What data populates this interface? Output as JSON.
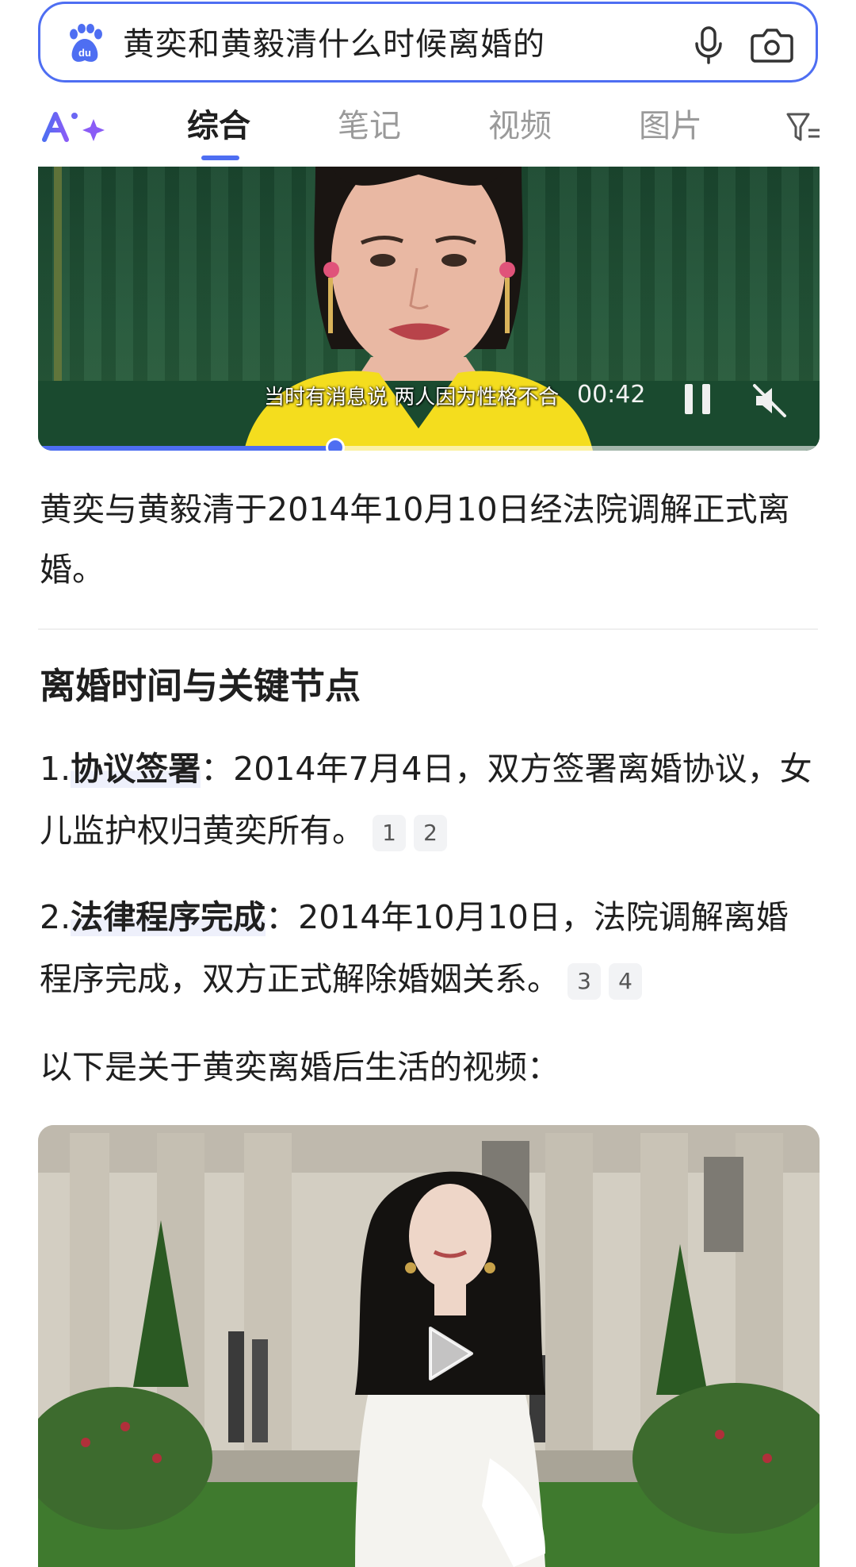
{
  "search": {
    "query": "黄奕和黄毅清什么时候离婚的",
    "logo_icon": "baidu-paw-icon",
    "mic_icon": "microphone-icon",
    "camera_icon": "camera-icon"
  },
  "tabs": {
    "ai_label": "Ai+",
    "items": [
      {
        "label": "综合",
        "active": true
      },
      {
        "label": "笔记",
        "active": false
      },
      {
        "label": "视频",
        "active": false
      },
      {
        "label": "图片",
        "active": false
      }
    ],
    "filter_icon": "filter-icon"
  },
  "video1": {
    "subtitle": "当时有消息说 两人因为性格不合",
    "time": "00:42",
    "progress": 0.38,
    "pause_icon": "pause-icon",
    "mute_icon": "mute-icon"
  },
  "answer": "黄奕与黄毅清于2014年10月10日经法院调解正式离婚。",
  "section": {
    "title": "离婚时间与关键节点",
    "items": [
      {
        "num": "1.",
        "keyword": "协议签署",
        "text": "：2014年7月4日，双方签署离婚协议，女儿监护权归黄奕所有。",
        "cites": [
          "1",
          "2"
        ]
      },
      {
        "num": "2.",
        "keyword": "法律程序完成",
        "text": "：2014年10月10日，法院调解离婚程序完成，双方正式解除婚姻关系。",
        "cites": [
          "3",
          "4"
        ]
      }
    ]
  },
  "intro": "以下是关于黄奕离婚后生活的视频：",
  "video2": {
    "play_icon": "play-icon"
  },
  "colors": {
    "accent": "#4e6ef2",
    "text": "#1f1f1f",
    "muted": "#9a9a9a"
  }
}
